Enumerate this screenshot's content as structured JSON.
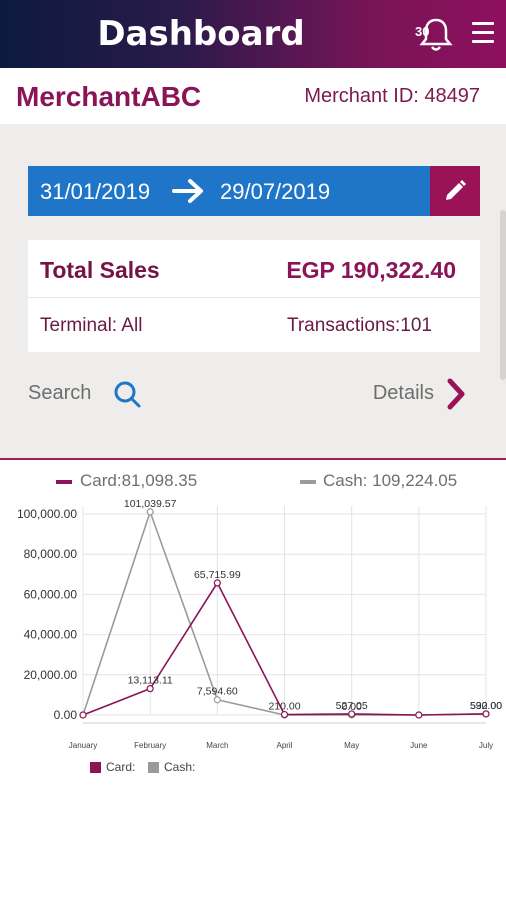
{
  "header": {
    "title": "Dashboard",
    "notification_count": "30"
  },
  "merchant": {
    "name": "MerchantABC",
    "id_text": "Merchant ID: 48497"
  },
  "date_range": {
    "from": "31/01/2019",
    "to": "29/07/2019"
  },
  "sales": {
    "total_label": "Total Sales",
    "total_value": "EGP 190,322.40",
    "terminal": "Terminal: All",
    "transactions": "Transactions:101"
  },
  "actions": {
    "search": "Search",
    "details": "Details"
  },
  "legend_top": {
    "card": "Card:81,098.35",
    "cash": "Cash: 109,224.05"
  },
  "colors": {
    "card": "#8a1456",
    "cash": "#9a9a9a",
    "accent": "#9a1257",
    "date_bar": "#1f75c8"
  },
  "chart_data": {
    "type": "line",
    "categories": [
      "January",
      "February",
      "March",
      "April",
      "May",
      "June",
      "July"
    ],
    "y_ticks": [
      "0.00",
      "20,000.00",
      "40,000.00",
      "60,000.00",
      "80,000.00",
      "100,000.00"
    ],
    "ylim": [
      0,
      100000
    ],
    "grid": true,
    "series": [
      {
        "name": "Card:",
        "color": "#8a1456",
        "values": [
          0,
          13113.11,
          65715.99,
          210.0,
          527.05,
          0,
          532.0
        ],
        "labels": [
          "",
          "13,113.11",
          "65,715.99",
          "210.00",
          "527.05",
          "",
          "532.00"
        ]
      },
      {
        "name": "Cash:",
        "color": "#9a9a9a",
        "values": [
          0,
          101039.57,
          7594.6,
          0,
          0,
          0,
          590.0
        ],
        "labels": [
          "",
          "101,039.57",
          "7,594.60",
          "",
          "0.00",
          "",
          "590.00"
        ]
      }
    ]
  }
}
